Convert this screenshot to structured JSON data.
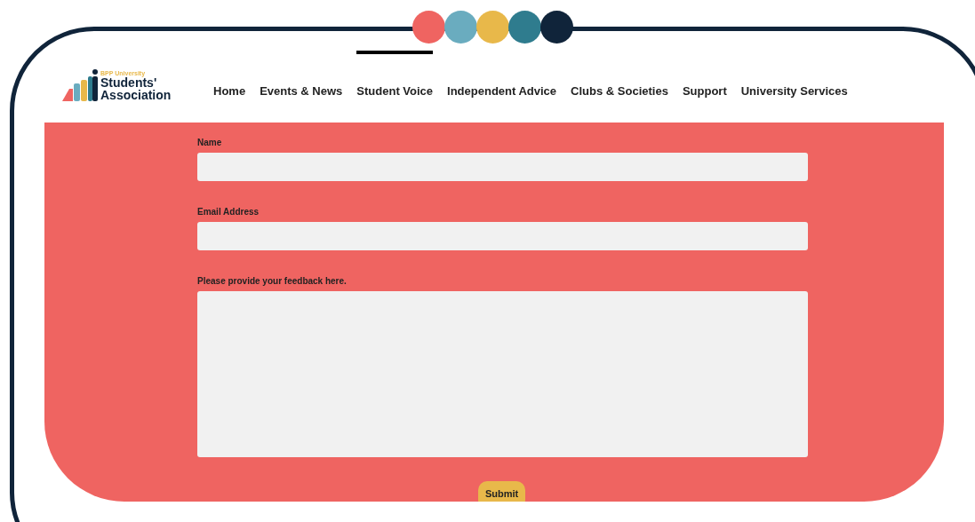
{
  "logo": {
    "university": "BPP University",
    "line_1": "Students'",
    "line_2": "Association"
  },
  "nav": [
    {
      "label": "Home",
      "selected": false
    },
    {
      "label": "Events & News",
      "selected": false
    },
    {
      "label": "Student Voice",
      "selected": true
    },
    {
      "label": "Independent Advice",
      "selected": false
    },
    {
      "label": "Clubs & Societies",
      "selected": false
    },
    {
      "label": "Support",
      "selected": false
    },
    {
      "label": "University Services",
      "selected": false
    }
  ],
  "form": {
    "fields": [
      {
        "label": "Name",
        "kind": "input"
      },
      {
        "label": "Email Address",
        "kind": "input"
      },
      {
        "label": "Please provide your feedback here.",
        "kind": "textarea"
      }
    ],
    "submit": "Submit"
  }
}
